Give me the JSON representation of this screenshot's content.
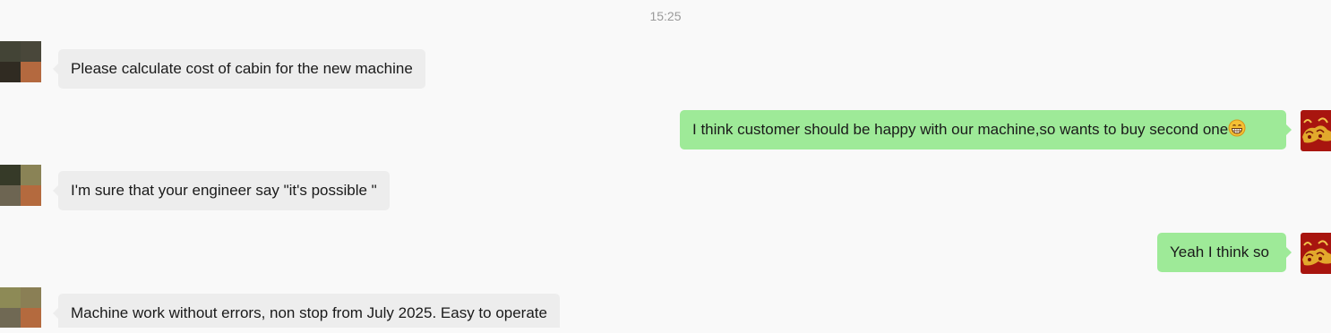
{
  "conversation": {
    "timestamp": "15:25",
    "messages": [
      {
        "direction": "incoming",
        "text": "Please calculate cost of cabin for the new machine"
      },
      {
        "direction": "outgoing",
        "text": "I think customer should be happy with our machine,so wants to buy second one",
        "emoji": "grinning-emoji"
      },
      {
        "direction": "incoming",
        "text": "I'm sure that your engineer say \"it's possible \""
      },
      {
        "direction": "outgoing",
        "text": "Yeah I think so"
      },
      {
        "direction": "incoming",
        "text": "Machine work without errors, non stop from July 2025. Easy to operate"
      }
    ]
  },
  "colors": {
    "background": "#f9f9f9",
    "incoming_bubble": "#ededed",
    "outgoing_bubble": "#9eea98",
    "timestamp_text": "#9a9a9a",
    "message_text": "#1a1a1a"
  }
}
